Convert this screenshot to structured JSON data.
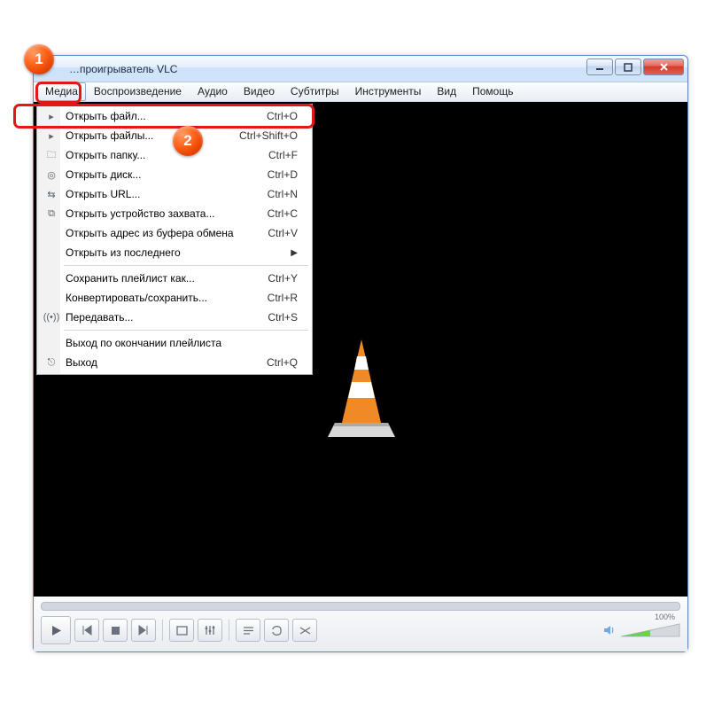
{
  "window": {
    "title": "…проигрыватель VLC"
  },
  "menubar": {
    "items": [
      "Медиа",
      "Воспроизведение",
      "Аудио",
      "Видео",
      "Субтитры",
      "Инструменты",
      "Вид",
      "Помощь"
    ]
  },
  "dropdown": {
    "rows": [
      {
        "icon": "play-file",
        "label": "Открыть файл...",
        "shortcut": "Ctrl+O"
      },
      {
        "icon": "play-file",
        "label": "Открыть файлы...",
        "shortcut": "Ctrl+Shift+O"
      },
      {
        "icon": "folder",
        "label": "Открыть папку...",
        "shortcut": "Ctrl+F"
      },
      {
        "icon": "disc",
        "label": "Открыть диск...",
        "shortcut": "Ctrl+D"
      },
      {
        "icon": "network",
        "label": "Открыть URL...",
        "shortcut": "Ctrl+N"
      },
      {
        "icon": "capture",
        "label": "Открыть устройство захвата...",
        "shortcut": "Ctrl+C"
      },
      {
        "icon": "",
        "label": "Открыть адрес из буфера обмена",
        "shortcut": "Ctrl+V"
      },
      {
        "icon": "",
        "label": "Открыть из последнего",
        "submenu": true
      }
    ],
    "rows2": [
      {
        "icon": "",
        "label": "Сохранить плейлист как...",
        "shortcut": "Ctrl+Y"
      },
      {
        "icon": "",
        "label": "Конвертировать/сохранить...",
        "shortcut": "Ctrl+R"
      },
      {
        "icon": "stream",
        "label": "Передавать...",
        "shortcut": "Ctrl+S"
      }
    ],
    "rows3": [
      {
        "icon": "",
        "label": "Выход по окончании плейлиста",
        "shortcut": ""
      },
      {
        "icon": "quit",
        "label": "Выход",
        "shortcut": "Ctrl+Q"
      }
    ]
  },
  "controls": {
    "volume_label": "100%"
  },
  "annotations": {
    "step1": "1",
    "step2": "2"
  }
}
